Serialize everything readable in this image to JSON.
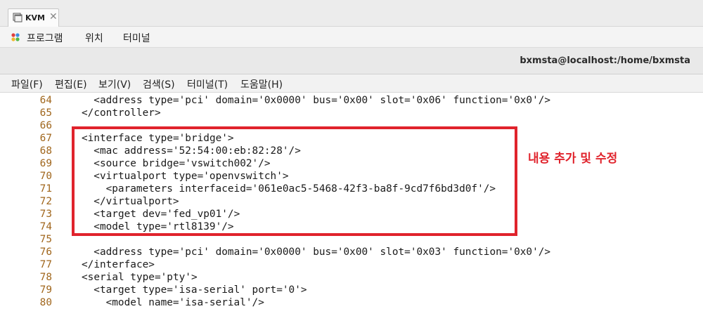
{
  "tab": {
    "title": "KVM",
    "close_glyph": "✕"
  },
  "app_menu": {
    "items": [
      "프로그램",
      "위치",
      "터미널"
    ]
  },
  "window": {
    "title": "bxmsta@localhost:/home/bxmsta"
  },
  "terminal_menu": {
    "items": [
      "파일(F)",
      "편집(E)",
      "보기(V)",
      "검색(S)",
      "터미널(T)",
      "도움말(H)"
    ]
  },
  "code_lines": [
    {
      "num": "64",
      "indent": 2,
      "text": "<address type='pci' domain='0x0000' bus='0x00' slot='0x06' function='0x0'/>"
    },
    {
      "num": "65",
      "indent": 1,
      "text": "</controller>"
    },
    {
      "num": "66",
      "indent": 0,
      "text": ""
    },
    {
      "num": "67",
      "indent": 1,
      "text": "<interface type='bridge'>"
    },
    {
      "num": "68",
      "indent": 2,
      "text": "<mac address='52:54:00:eb:82:28'/>"
    },
    {
      "num": "69",
      "indent": 2,
      "text": "<source bridge='vswitch002'/>"
    },
    {
      "num": "70",
      "indent": 2,
      "text": "<virtualport type='openvswitch'>"
    },
    {
      "num": "71",
      "indent": 3,
      "text": "<parameters interfaceid='061e0ac5-5468-42f3-ba8f-9cd7f6bd3d0f'/>"
    },
    {
      "num": "72",
      "indent": 2,
      "text": "</virtualport>"
    },
    {
      "num": "73",
      "indent": 2,
      "text": "<target dev='fed_vp01'/>"
    },
    {
      "num": "74",
      "indent": 2,
      "text": "<model type='rtl8139'/>"
    },
    {
      "num": "75",
      "indent": 0,
      "text": ""
    },
    {
      "num": "76",
      "indent": 2,
      "text": "<address type='pci' domain='0x0000' bus='0x00' slot='0x03' function='0x0'/>"
    },
    {
      "num": "77",
      "indent": 1,
      "text": "</interface>"
    },
    {
      "num": "78",
      "indent": 1,
      "text": "<serial type='pty'>"
    },
    {
      "num": "79",
      "indent": 2,
      "text": "<target type='isa-serial' port='0'>"
    },
    {
      "num": "80",
      "indent": 3,
      "text": "<model name='isa-serial'/>"
    }
  ],
  "annotation": {
    "text": "내용 추가 및 수정",
    "color": "#e0232c"
  },
  "colors": {
    "line_number": "#a0661c",
    "highlight": "#e0232c"
  },
  "icons": {
    "tab": "terminal-tab-icon",
    "programs": "programs-icon"
  }
}
